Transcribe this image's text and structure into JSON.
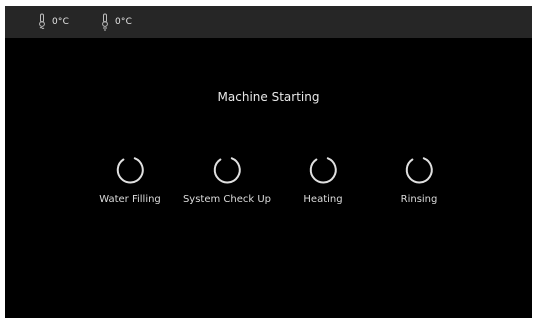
{
  "status_bar": {
    "temperatures": [
      {
        "icon": "thermometer-water-icon",
        "value": "0°C"
      },
      {
        "icon": "thermometer-steam-icon",
        "value": "0°C"
      }
    ]
  },
  "main": {
    "title": "Machine Starting",
    "steps": [
      {
        "label": "Water Filling",
        "icon": "loading-spinner-icon"
      },
      {
        "label": "System Check Up",
        "icon": "loading-spinner-icon"
      },
      {
        "label": "Heating",
        "icon": "loading-spinner-icon"
      },
      {
        "label": "Rinsing",
        "icon": "loading-spinner-icon"
      }
    ]
  },
  "colors": {
    "background": "#000000",
    "status_bar": "#262626",
    "text": "#e6e6e6",
    "spinner": "#e0e0e0"
  }
}
